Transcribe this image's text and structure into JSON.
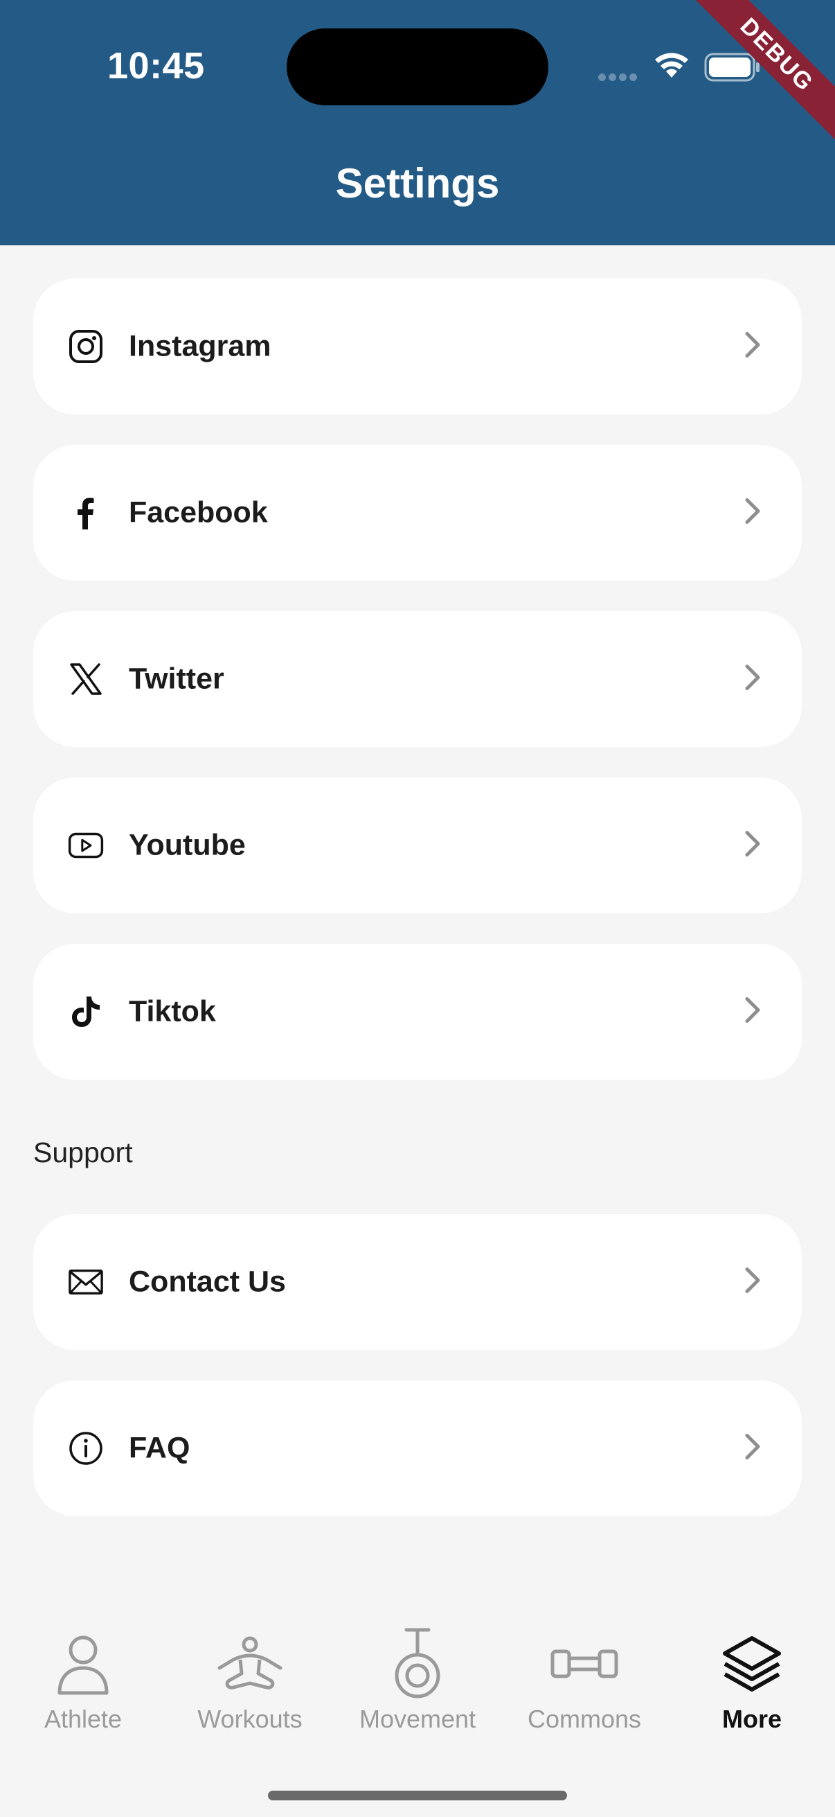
{
  "status_bar": {
    "time": "10:45",
    "debug_banner": "DEBUG"
  },
  "header": {
    "title": "Settings"
  },
  "social_items": [
    {
      "label": "Instagram",
      "icon": "instagram-icon"
    },
    {
      "label": "Facebook",
      "icon": "facebook-icon"
    },
    {
      "label": "Twitter",
      "icon": "x-twitter-icon"
    },
    {
      "label": "Youtube",
      "icon": "youtube-icon"
    },
    {
      "label": "Tiktok",
      "icon": "tiktok-icon"
    }
  ],
  "support": {
    "heading": "Support",
    "items": [
      {
        "label": "Contact Us",
        "icon": "mail-icon"
      },
      {
        "label": "FAQ",
        "icon": "info-icon"
      }
    ]
  },
  "bottom_nav": {
    "items": [
      {
        "label": "Athlete",
        "icon": "person-icon",
        "active": false
      },
      {
        "label": "Workouts",
        "icon": "meditation-icon",
        "active": false
      },
      {
        "label": "Movement",
        "icon": "kettlebell-icon",
        "active": false
      },
      {
        "label": "Commons",
        "icon": "dumbbell-icon",
        "active": false
      },
      {
        "label": "More",
        "icon": "layers-icon",
        "active": true
      }
    ]
  },
  "colors": {
    "header_bg": "#245b86",
    "page_bg": "#f5f5f5",
    "debug_bg": "#8a2235",
    "chevron": "#8e8e8e",
    "nav_inactive": "#9a9a9a",
    "nav_active": "#111111"
  }
}
